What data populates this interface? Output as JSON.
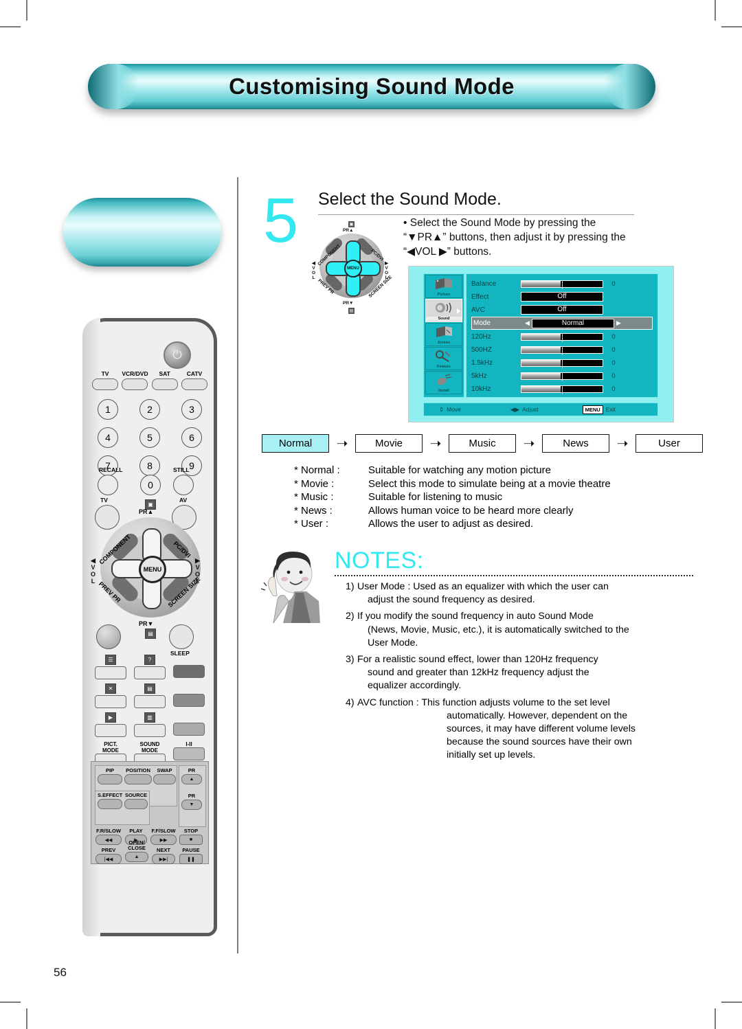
{
  "page": {
    "header_title": "Customising Sound Mode",
    "page_number": "56"
  },
  "step": {
    "number": "5",
    "title": "Select the Sound Mode.",
    "bullet": "• Select the Sound Mode by pressing the “▼PR▲” buttons, then adjust it by pressing the “◀VOL ▶” buttons."
  },
  "navpad": {
    "pr_up": "PR▲",
    "pr_down": "PR▼",
    "component": "COMPONENT",
    "pcdvi": "PC/DVI",
    "prev_pr": "PREV PR",
    "screen_size": "SCREEN SIZE",
    "menu": "MENU",
    "vol_left": "◀ V O L",
    "vol_right": "▶ V O L",
    "vol_word": "VOL"
  },
  "osd": {
    "sidebar": [
      {
        "label": "Picture",
        "icon": "picture-icon",
        "selected": false
      },
      {
        "label": "Sound",
        "icon": "sound-icon",
        "selected": true
      },
      {
        "label": "Screen",
        "icon": "screen-icon",
        "selected": false
      },
      {
        "label": "Feature",
        "icon": "feature-icon",
        "selected": false
      },
      {
        "label": "Install",
        "icon": "install-icon",
        "selected": false
      }
    ],
    "rows": [
      {
        "label": "Balance",
        "type": "bar",
        "value": "0",
        "fill": 48
      },
      {
        "label": "Effect",
        "type": "option",
        "value": "Off"
      },
      {
        "label": "AVC",
        "type": "option",
        "value": "Off"
      },
      {
        "label": "Mode",
        "type": "option",
        "value": "Normal",
        "selected": true
      },
      {
        "label": "120Hz",
        "type": "bar",
        "value": "0",
        "fill": 48
      },
      {
        "label": "500HZ",
        "type": "bar",
        "value": "0",
        "fill": 48
      },
      {
        "label": "1.5kHz",
        "type": "bar",
        "value": "0",
        "fill": 48
      },
      {
        "label": "5kHz",
        "type": "bar",
        "value": "0",
        "fill": 48
      },
      {
        "label": "10kHz",
        "type": "bar",
        "value": "0",
        "fill": 48
      }
    ],
    "footer": {
      "move": "Move",
      "adjust": "Adjust",
      "menu_key": "MENU",
      "exit": "Exit"
    },
    "accent_color": "#13b6c0",
    "background_color": "#8ff0ef"
  },
  "flow": {
    "items": [
      {
        "label": "Normal",
        "highlighted": true
      },
      {
        "label": "Movie",
        "highlighted": false
      },
      {
        "label": "Music",
        "highlighted": false
      },
      {
        "label": "News",
        "highlighted": false
      },
      {
        "label": "User",
        "highlighted": false
      }
    ],
    "arrow": "➝",
    "highlight_color": "#a9f0f5"
  },
  "descriptions": [
    {
      "key": "* Normal :",
      "text": "Suitable for watching any motion picture"
    },
    {
      "key": "* Movie :",
      "text": "Select this mode to simulate being at a movie theatre"
    },
    {
      "key": "* Music :",
      "text": "Suitable for listening to music"
    },
    {
      "key": "* News :",
      "text": "Allows human voice to be heard more clearly"
    },
    {
      "key": "* User :",
      "text": "Allows the user to adjust as desired."
    }
  ],
  "notes": {
    "title": "NOTES:",
    "title_color": "#35e8f0",
    "items": [
      {
        "n": "1)",
        "l1": "User Mode : Used as an equalizer with which the user can",
        "l2": "adjust the sound frequency as desired.",
        "l3": "",
        "l4": "",
        "l5": ""
      },
      {
        "n": "2)",
        "l1": "If you modify the sound frequency in auto Sound Mode",
        "l2": "(News, Movie, Music, etc.), it is automatically switched to the",
        "l3": "User Mode.",
        "l4": "",
        "l5": ""
      },
      {
        "n": "3)",
        "l1": "For a realistic sound effect, lower than 120Hz frequency",
        "l2": "sound and greater than 12kHz frequency adjust the",
        "l3": "equalizer accordingly.",
        "l4": "",
        "l5": ""
      },
      {
        "n": "4)",
        "l1": "AVC function : This function adjusts volume to the set level",
        "l2": "automatically. However, dependent on the",
        "l3": "sources, it may have different volume levels",
        "l4": "because the sound sources have their own",
        "l5": "initially set up levels."
      }
    ]
  },
  "remote": {
    "power": "⏻",
    "sources": [
      "TV",
      "VCR/DVD",
      "SAT",
      "CATV"
    ],
    "numbers": [
      [
        "1",
        "2",
        "3"
      ],
      [
        "4",
        "5",
        "6"
      ],
      [
        "7",
        "8",
        "9"
      ]
    ],
    "zero": "0",
    "recall": "RECALL",
    "still": "STILL",
    "tv": "TV",
    "av": "AV",
    "sleep": "SLEEP",
    "pict_mode": "PICT.\nMODE",
    "pict_mode_l1": "PICT.",
    "pict_mode_l2": "MODE",
    "sound_mode_l1": "SOUND",
    "sound_mode_l2": "MODE",
    "i_ii": "I-II",
    "vcr": {
      "pip": "PIP",
      "position": "POSITION",
      "swap": "SWAP",
      "pr_up": "PR",
      "pr_up_glyph": "▲",
      "pr_dn": "PR",
      "pr_dn_glyph": "▼",
      "s_effect": "S.EFFECT",
      "source": "SOURCE",
      "fr_slow": "F.R/SLOW",
      "fr_glyph": "◀◀",
      "play": "PLAY",
      "play_glyph": "▶",
      "ff_slow": "F.F/SLOW",
      "ff_glyph": "▶▶",
      "stop": "STOP",
      "stop_glyph": "■",
      "prev": "PREV",
      "prev_glyph": "|◀◀",
      "open_close_l1": "OPEN/",
      "open_close_l2": "CLOSE",
      "open_glyph": "▲",
      "next": "NEXT",
      "next_glyph": "▶▶|",
      "pause": "PAUSE",
      "pause_glyph": "❚❚"
    }
  }
}
